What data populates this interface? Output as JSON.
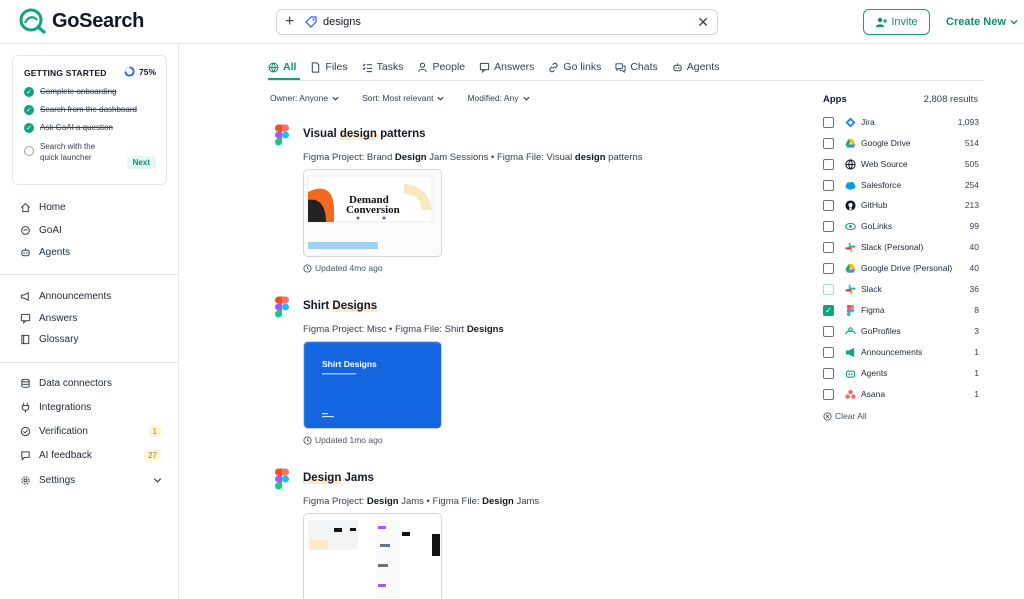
{
  "app": {
    "name": "GoSearch"
  },
  "search": {
    "query": "designs"
  },
  "header": {
    "invite_label": "Invite",
    "create_label": "Create New"
  },
  "getting_started": {
    "title": "GETTING STARTED",
    "percent": "75%",
    "progress_fraction": 0.75,
    "steps": [
      {
        "label": "Complete onboarding",
        "done": true
      },
      {
        "label": "Search from the dashboard",
        "done": true
      },
      {
        "label": "Ask GoAI a question",
        "done": true
      },
      {
        "label": "Search with the quick launcher",
        "done": false
      }
    ],
    "next_label": "Next"
  },
  "sidebar": {
    "items": [
      {
        "label": "Home",
        "icon": "home-icon"
      },
      {
        "label": "GoAI",
        "icon": "goai-icon"
      },
      {
        "label": "Agents",
        "icon": "agents-icon"
      },
      {
        "label": "Announcements",
        "icon": "megaphone-icon"
      },
      {
        "label": "Answers",
        "icon": "answers-icon"
      },
      {
        "label": "Glossary",
        "icon": "book-icon"
      },
      {
        "label": "Data connectors",
        "icon": "database-icon"
      },
      {
        "label": "Integrations",
        "icon": "plug-icon"
      },
      {
        "label": "Verification",
        "icon": "verify-icon",
        "badge": "1"
      },
      {
        "label": "AI feedback",
        "icon": "feedback-icon",
        "badge": "27"
      },
      {
        "label": "Settings",
        "icon": "gear-icon"
      }
    ]
  },
  "tabs": [
    {
      "label": "All",
      "active": true
    },
    {
      "label": "Files"
    },
    {
      "label": "Tasks"
    },
    {
      "label": "People"
    },
    {
      "label": "Answers"
    },
    {
      "label": "Go links"
    },
    {
      "label": "Chats"
    },
    {
      "label": "Agents"
    }
  ],
  "filters": {
    "owner": "Owner: Anyone",
    "sort": "Sort: Most relevant",
    "modified": "Modified: Any"
  },
  "results": [
    {
      "title_pre": "Visual ",
      "title_hl": "design",
      "title_post": " patterns",
      "sub": [
        "Figma Project: Brand ",
        "Design",
        " Jam Sessions • Figma File: Visual ",
        "design",
        " patterns"
      ],
      "updated": "Updated 4mo ago",
      "thumb_text1": "Demand",
      "thumb_text2": "Conversion"
    },
    {
      "title_pre": "Shirt ",
      "title_hl": "Designs",
      "title_post": "",
      "sub": [
        "Figma Project: Misc • Figma File: Shirt ",
        "Designs",
        "",
        "",
        ""
      ],
      "updated": "Updated 1mo ago",
      "thumb_text1": "Shirt Designs"
    },
    {
      "title_pre": "",
      "title_hl": "Design",
      "title_post": " Jams",
      "sub": [
        "Figma Project: ",
        "Design",
        " Jams • Figma File: ",
        "Design",
        " Jams"
      ],
      "updated": ""
    }
  ],
  "apps_panel": {
    "heading": "Apps",
    "results": "2,808 results",
    "clear_label": "Clear All",
    "items": [
      {
        "name": "Jira",
        "count": "1,093",
        "checked": false,
        "icon": "jira-icon",
        "color": "#2684ff"
      },
      {
        "name": "Google Drive",
        "count": "514",
        "checked": false,
        "icon": "google-drive-icon",
        "color": "#fbbc04"
      },
      {
        "name": "Web Source",
        "count": "505",
        "checked": false,
        "icon": "globe-icon",
        "color": "#111827"
      },
      {
        "name": "Salesforce",
        "count": "254",
        "checked": false,
        "icon": "salesforce-icon",
        "color": "#00a1e0"
      },
      {
        "name": "GitHub",
        "count": "213",
        "checked": false,
        "icon": "github-icon",
        "color": "#111827"
      },
      {
        "name": "GoLinks",
        "count": "99",
        "checked": false,
        "icon": "golinks-icon",
        "color": "#10a37f"
      },
      {
        "name": "Slack (Personal)",
        "count": "40",
        "checked": false,
        "icon": "slack-icon",
        "color": "#e01e5a"
      },
      {
        "name": "Google Drive (Personal)",
        "count": "40",
        "checked": false,
        "icon": "google-drive-icon",
        "color": "#fbbc04"
      },
      {
        "name": "Slack",
        "count": "36",
        "checked": false,
        "light": true,
        "icon": "slack-icon",
        "color": "#e01e5a"
      },
      {
        "name": "Figma",
        "count": "8",
        "checked": true,
        "icon": "figma-icon",
        "color": "#f24e1e"
      },
      {
        "name": "GoProfiles",
        "count": "3",
        "checked": false,
        "icon": "goprofiles-icon",
        "color": "#10a37f"
      },
      {
        "name": "Announcements",
        "count": "1",
        "checked": false,
        "icon": "megaphone-icon",
        "color": "#10a37f"
      },
      {
        "name": "Agents",
        "count": "1",
        "checked": false,
        "icon": "agents-icon",
        "color": "#10a37f"
      },
      {
        "name": "Asana",
        "count": "1",
        "checked": false,
        "icon": "asana-icon",
        "color": "#f06a6a"
      }
    ]
  }
}
